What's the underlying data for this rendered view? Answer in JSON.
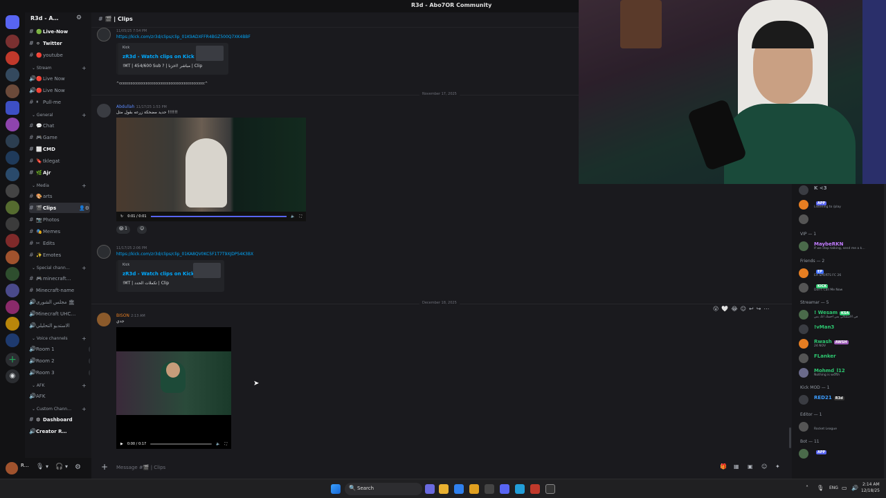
{
  "window": {
    "title": "R3d - Abo7OR Community"
  },
  "server": {
    "name": "R3d - A…"
  },
  "channels": [
    {
      "type": "text",
      "emoji": "🟢",
      "label": "Live-Now",
      "bold": true
    },
    {
      "type": "text",
      "emoji": "⚪",
      "label": "Twitter",
      "bold": true
    },
    {
      "type": "text",
      "emoji": "🔴",
      "label": "youtube"
    },
    {
      "type": "cat",
      "label": "Stream"
    },
    {
      "type": "voice",
      "emoji": "🔴",
      "label": "Live Now"
    },
    {
      "type": "voice",
      "emoji": "🔴",
      "label": "Live Now"
    },
    {
      "type": "text",
      "emoji": "⏸",
      "label": "Pull-me"
    },
    {
      "type": "cat",
      "label": "General"
    },
    {
      "type": "text",
      "emoji": "💬",
      "label": "Chat"
    },
    {
      "type": "text",
      "emoji": "🎮",
      "label": "Game"
    },
    {
      "type": "text",
      "emoji": "⬜",
      "label": "CMD",
      "bold": true
    },
    {
      "type": "text",
      "emoji": "🔖",
      "label": "tklegat"
    },
    {
      "type": "text",
      "emoji": "🌿",
      "label": "Ajr",
      "bold": true
    },
    {
      "type": "cat",
      "label": "Media"
    },
    {
      "type": "text",
      "emoji": "🎨",
      "label": "arts"
    },
    {
      "type": "text",
      "emoji": "🎬",
      "label": "Clips",
      "selected": true
    },
    {
      "type": "text",
      "emoji": "📷",
      "label": "Photos"
    },
    {
      "type": "text",
      "emoji": "🎭",
      "label": "Memes"
    },
    {
      "type": "text",
      "emoji": "✂",
      "label": "Edits"
    },
    {
      "type": "text",
      "emoji": "✨",
      "label": "Emotes"
    },
    {
      "type": "cat",
      "label": "Special chann…"
    },
    {
      "type": "text",
      "emoji": "🎮",
      "label": "minecraft…"
    },
    {
      "type": "text",
      "emoji": "",
      "label": "Minecraft-name"
    },
    {
      "type": "voice",
      "emoji": "",
      "label": "مجلس الشورى 🏛"
    },
    {
      "type": "voice",
      "emoji": "",
      "label": "Minecraft UHC…"
    },
    {
      "type": "voice",
      "emoji": "",
      "label": "الاستديو التحليلي"
    },
    {
      "type": "cat",
      "label": "Voice channels"
    },
    {
      "type": "voice",
      "emoji": "",
      "label": "Room 1",
      "count": "00 02"
    },
    {
      "type": "voice",
      "emoji": "",
      "label": "Room 2",
      "count": "00 04"
    },
    {
      "type": "voice",
      "emoji": "",
      "label": "Room 3",
      "count": "00 06"
    },
    {
      "type": "cat",
      "label": "AFK"
    },
    {
      "type": "voice",
      "emoji": "",
      "label": "AFK"
    },
    {
      "type": "cat",
      "label": "Custom Chann…"
    },
    {
      "type": "text",
      "emoji": "⚙",
      "label": "Dashboard",
      "bold": true
    },
    {
      "type": "voice",
      "emoji": "",
      "label": "Creator R…",
      "bold": true
    }
  ],
  "chat": {
    "channel": "Clips",
    "msg1": {
      "meta": "11/05/25 7:54 PM",
      "link": "https://kick.com/zr3d/clips/clip_01K9ADXFFR4BGZ500Q7XK4BBF",
      "provider": "Kick",
      "title": "zR3d - Watch clips on Kick",
      "desc": "!MT | 454/600 Sub ? | مباشر !اخزنا | Clip",
      "text": "^ccccccccccccccccccccccccccccccccccccccccccccc^"
    },
    "date1": "November 17, 2025",
    "msg2": {
      "name": "Abdullah",
      "meta": "11/17/25 1:53 PM",
      "text": "حديد مضحكة زرعه بقول متل !!!!!!",
      "time": "0:01 / 0:01",
      "reaction": "1"
    },
    "msg3": {
      "meta": "11/17/25 2:06 PM",
      "link": "https://kick.com/zr3d/clips/clip_01KA8QV0KC5F1T7T9XJDP54K3BX",
      "provider": "Kick",
      "title": "zR3d - Watch clips on Kick",
      "desc": "!MT | تكملات الحدد | Clip"
    },
    "date2": "December 18, 2025",
    "msg4": {
      "name": "BISON",
      "meta": "2:13 AM",
      "text": "جدي",
      "time": "0:00 / 0:17"
    },
    "placeholder": "Message #🎬 | Clips"
  },
  "members": {
    "items": [
      {
        "name": "K <3",
        "status": "",
        "color": "#949ba4"
      },
      {
        "name": "",
        "status": "Listening to /play",
        "color": "#dbdee1",
        "tag": "APP"
      },
      {
        "name": "",
        "status": "",
        "color": "#dbdee1"
      },
      {
        "cat": "VIP — 1"
      },
      {
        "name": "MaybeRKN",
        "status": "If we stop talking, send me a k…",
        "color": "#c27cff"
      },
      {
        "cat": "Friends — 2"
      },
      {
        "name": "",
        "status": "EA SPORTS FC 26",
        "color": "#3b6cff",
        "tag": "EP"
      },
      {
        "name": "",
        "status": "Don't Call Me Now",
        "color": "#3b6cff",
        "tag": "KICK"
      },
      {
        "cat": "Streamar — 5"
      },
      {
        "name": "! Wesam",
        "status": "في الاستثنائي بس احسك انك بس",
        "color": "#2dc770",
        "tag": "KSA"
      },
      {
        "name": "!vMan3",
        "status": "",
        "color": "#2dc770"
      },
      {
        "name": "Rwash",
        "status": "24 NOV",
        "color": "#2dc770",
        "tag": "AWSH"
      },
      {
        "name": "FLanker",
        "status": "",
        "color": "#2dc770"
      },
      {
        "name": "Mohmd_l12",
        "status": "Nothing is worth",
        "color": "#2dc770"
      },
      {
        "cat": "Kick MOD — 1"
      },
      {
        "name": "RED21",
        "status": "",
        "color": "#3b9cff",
        "tag": "R3d"
      },
      {
        "cat": "Editor — 1"
      },
      {
        "name": "",
        "status": "Rocket League",
        "color": "#dbdee1"
      },
      {
        "cat": "Bot — 11"
      },
      {
        "name": "",
        "status": "",
        "color": "#dbdee1",
        "tag": "APP"
      }
    ]
  },
  "taskbar": {
    "search": "Search",
    "time": "2:14 AM",
    "date": "12/18/25",
    "lang": "ENG"
  }
}
